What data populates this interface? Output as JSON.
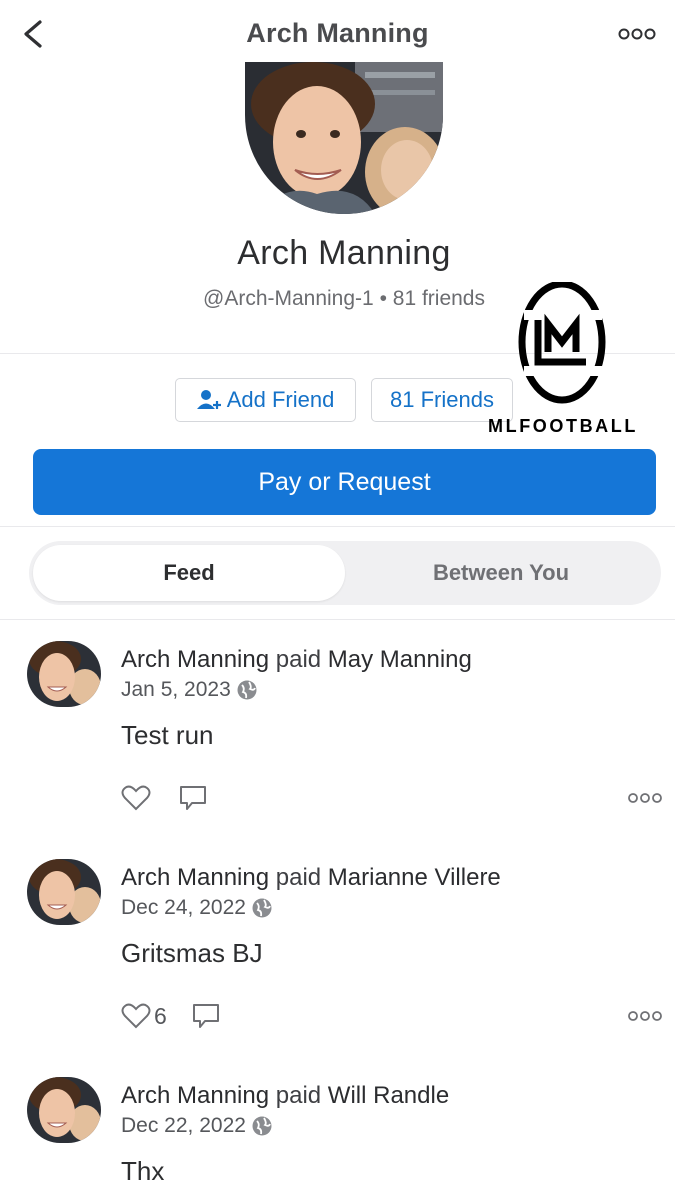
{
  "header": {
    "title": "Arch Manning",
    "back_icon": "chevron-left-icon",
    "more_icon": "more-horizontal-icon"
  },
  "profile": {
    "name": "Arch Manning",
    "username": "@Arch-Manning-1",
    "friends_count": "81 friends",
    "separator": "•"
  },
  "actions": {
    "add_friend_label": "Add Friend",
    "friends_label": "81 Friends",
    "pay_label": "Pay or Request"
  },
  "watermark": {
    "text": "MLFOOTBALL"
  },
  "tabs": [
    {
      "label": "Feed",
      "active": true
    },
    {
      "label": "Between You",
      "active": false
    }
  ],
  "feed": [
    {
      "payer": "Arch Manning",
      "verb": "paid",
      "payee": "May Manning",
      "date": "Jan 5, 2023",
      "note": "Test run",
      "likes": ""
    },
    {
      "payer": "Arch Manning",
      "verb": "paid",
      "payee": "Marianne Villere",
      "date": "Dec 24, 2022",
      "note": "Gritsmas BJ",
      "likes": "6"
    },
    {
      "payer": "Arch Manning",
      "verb": "paid",
      "payee": "Will Randle",
      "date": "Dec 22, 2022",
      "note": "Thx",
      "likes": ""
    }
  ],
  "colors": {
    "accent": "#1576d7",
    "link": "#1572c8",
    "text": "#2d2e30",
    "muted": "#6b6c70"
  }
}
